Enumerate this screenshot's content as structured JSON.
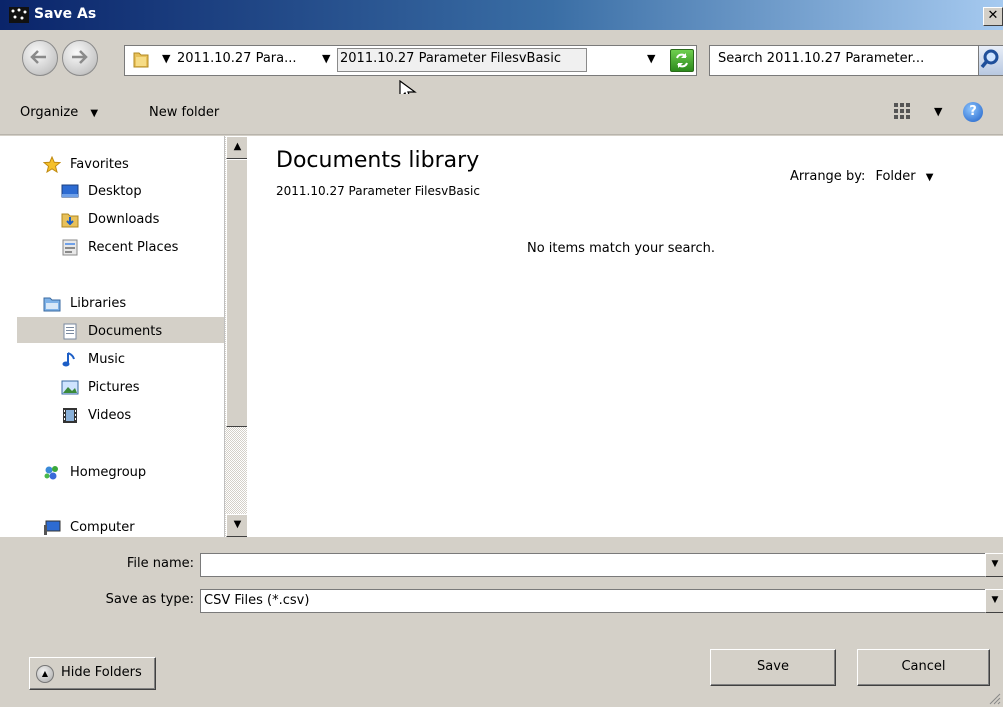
{
  "window": {
    "title": "Save As",
    "close_glyph": "✕"
  },
  "address": {
    "crumbs": [
      "2011.10.27 Para...",
      "2011.10.27 Parameter FilesvBasic"
    ],
    "search_placeholder": "Search 2011.10.27 Parameter..."
  },
  "toolbar": {
    "organize_label": "Organize",
    "new_folder_label": "New folder",
    "help_glyph": "?"
  },
  "nav": {
    "favorites": {
      "label": "Favorites",
      "items": [
        "Desktop",
        "Downloads",
        "Recent Places"
      ]
    },
    "libraries": {
      "label": "Libraries",
      "items": [
        "Documents",
        "Music",
        "Pictures",
        "Videos"
      ]
    },
    "homegroup": "Homegroup",
    "computer": "Computer",
    "selected": "Documents"
  },
  "content": {
    "title": "Documents library",
    "subtitle": "2011.10.27 Parameter FilesvBasic",
    "arrange_label": "Arrange by:",
    "arrange_value": "Folder",
    "empty_message": "No items match your search."
  },
  "form": {
    "file_name_label": "File name:",
    "file_name_value": "",
    "save_type_label": "Save as type:",
    "save_type_value": "CSV Files (*.csv)"
  },
  "buttons": {
    "hide_folders": "Hide Folders",
    "save": "Save",
    "cancel": "Cancel"
  },
  "colors": {
    "title_bar_start": "#0a246a",
    "dialog_face": "#d4d0c8",
    "selection": "#d4d0c8"
  }
}
